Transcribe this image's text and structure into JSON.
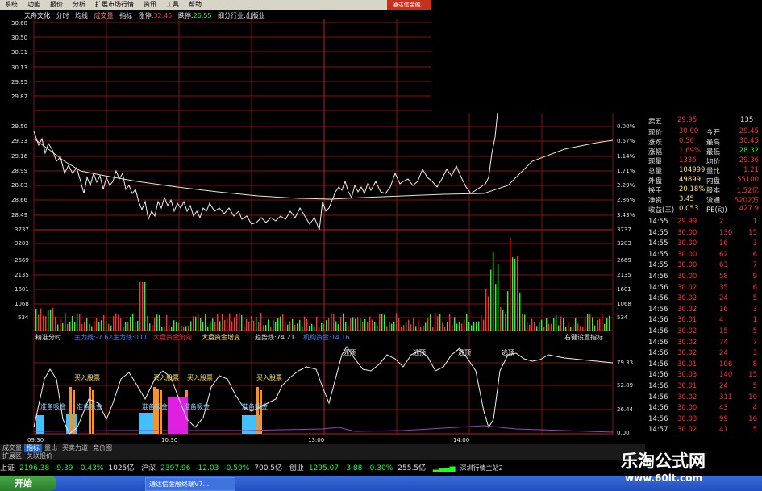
{
  "menubar": {
    "items": [
      "系统",
      "功能",
      "报价",
      "分析",
      "扩展市场行情",
      "资讯",
      "工具",
      "帮助"
    ],
    "title": "通达信金融..."
  },
  "header": {
    "stock": "天舟文化",
    "tabs": [
      "分时",
      "均线",
      "成交量",
      "指标"
    ],
    "limit_up_label": "涨停:",
    "limit_up": "32.45",
    "limit_down_label": "跌停:",
    "limit_down": "26.55",
    "industry": "细分行业:出版业"
  },
  "price_axis_left": [
    "30.68",
    "30.50",
    "30.31",
    "30.13",
    "29.95",
    "29.87",
    "29.50",
    "29.33",
    "29.16",
    "28.99",
    "28.83",
    "28.66",
    "28.49"
  ],
  "pct_axis_right": [
    "0.00%",
    "0.57%",
    "1.14%",
    "1.71%",
    "2.29%",
    "2.86%",
    "3.43%"
  ],
  "volume_axis": [
    "3737",
    "3203",
    "2669",
    "2135",
    "1601",
    "1068",
    "534"
  ],
  "indicator_bar": {
    "name": "精准分时",
    "items": [
      "主力线:-7.62",
      "主力线:0.00",
      "大盘资金流向",
      "大盘资金增变",
      "趋势线:74.21",
      "机构资金:14.16"
    ],
    "right": "右键设置指标"
  },
  "indicator_axis": [
    "79.33",
    "52.89",
    "26.44",
    "0.00"
  ],
  "time_axis": [
    "09:30",
    "10:30",
    "13:00",
    "14:00"
  ],
  "signals": {
    "buy": "买入股票",
    "prep": "准备吸金",
    "sell": "逃顶"
  },
  "quote": {
    "ask5": {
      "label": "卖五",
      "price": "29.95",
      "vol": "135"
    },
    "fields": [
      {
        "l1": "现价",
        "v1": "30.00",
        "l2": "今开",
        "v2": "29.45"
      },
      {
        "l1": "涨跌",
        "v1": "0.50",
        "l2": "最高",
        "v2": "30.45"
      },
      {
        "l1": "涨幅",
        "v1": "1.69%",
        "l2": "最低",
        "v2": "28.32"
      },
      {
        "l1": "现量",
        "v1": "1336",
        "l2": "均价",
        "v2": "29.36"
      },
      {
        "l1": "总量",
        "v1": "104999",
        "l2": "量比",
        "v2": "1.21"
      },
      {
        "l1": "外盘",
        "v1": "49899",
        "l2": "内盘",
        "v2": "55100"
      },
      {
        "l1": "换手",
        "v1": "20.18%",
        "l2": "股本",
        "v2": "1.52亿"
      },
      {
        "l1": "净资",
        "v1": "3.45",
        "l2": "流通",
        "v2": "5202万"
      },
      {
        "l1": "收益(三)",
        "v1": "0.053",
        "l2": "PE(动)",
        "v2": "427.9"
      }
    ],
    "ticks": [
      [
        "14:55",
        "29.99",
        "2",
        "1"
      ],
      [
        "14:55",
        "30.00",
        "130",
        "15"
      ],
      [
        "14:55",
        "30.00",
        "16",
        "3"
      ],
      [
        "14:55",
        "30.00",
        "62",
        "6"
      ],
      [
        "14:55",
        "30.00",
        "63",
        "7"
      ],
      [
        "14:56",
        "30.00",
        "58",
        "9"
      ],
      [
        "14:56",
        "30.02",
        "35",
        "6"
      ],
      [
        "14:56",
        "30.02",
        "24",
        "5"
      ],
      [
        "14:56",
        "30.02",
        "16",
        "3"
      ],
      [
        "14:56",
        "30.01",
        "4",
        "1"
      ],
      [
        "14:56",
        "30.02",
        "15",
        "5"
      ],
      [
        "14:56",
        "30.02",
        "74",
        "7"
      ],
      [
        "14:56",
        "30.02",
        "24",
        "3"
      ],
      [
        "14:56",
        "30.01",
        "106",
        "8"
      ],
      [
        "14:56",
        "30.03",
        "140",
        "15"
      ],
      [
        "14:56",
        "30.01",
        "24",
        "5"
      ],
      [
        "14:56",
        "30.02",
        "311",
        "10"
      ],
      [
        "14:56",
        "30.00",
        "43",
        "4"
      ],
      [
        "14:56",
        "30.03",
        "99",
        "16"
      ],
      [
        "14:57",
        "30.02",
        "41",
        "5"
      ]
    ]
  },
  "tabs": [
    "成交量",
    "指标",
    "量比",
    "买卖力道",
    "竞价图"
  ],
  "tabs2": [
    "扩展区",
    "关联报价"
  ],
  "indices": [
    {
      "name": "上证",
      "value": "2196.38",
      "chg": "-9.39",
      "pct": "-0.43%",
      "amt": "1025亿"
    },
    {
      "name": "沪深",
      "value": "2397.96",
      "chg": "-12.03",
      "pct": "-0.50%",
      "amt": "700.5亿"
    },
    {
      "name": "创业",
      "value": "1295.07",
      "chg": "-3.88",
      "pct": "-0.30%",
      "amt": "255.5亿"
    }
  ],
  "status_right": "深圳行情主站2",
  "taskbar": {
    "start": "开始",
    "window": "通达信金融终端V7..."
  },
  "watermark": {
    "cn": "乐淘公式网",
    "url": "www.60lt.com"
  },
  "colors": {
    "grid": "#8a1010",
    "up": "#ff3030",
    "down": "#20ff20",
    "price_line": "#f0f0f0",
    "avg_line": "#e8e8b0",
    "cyan": "#40c0ff",
    "orange": "#ff9020",
    "magenta": "#e020e0"
  }
}
